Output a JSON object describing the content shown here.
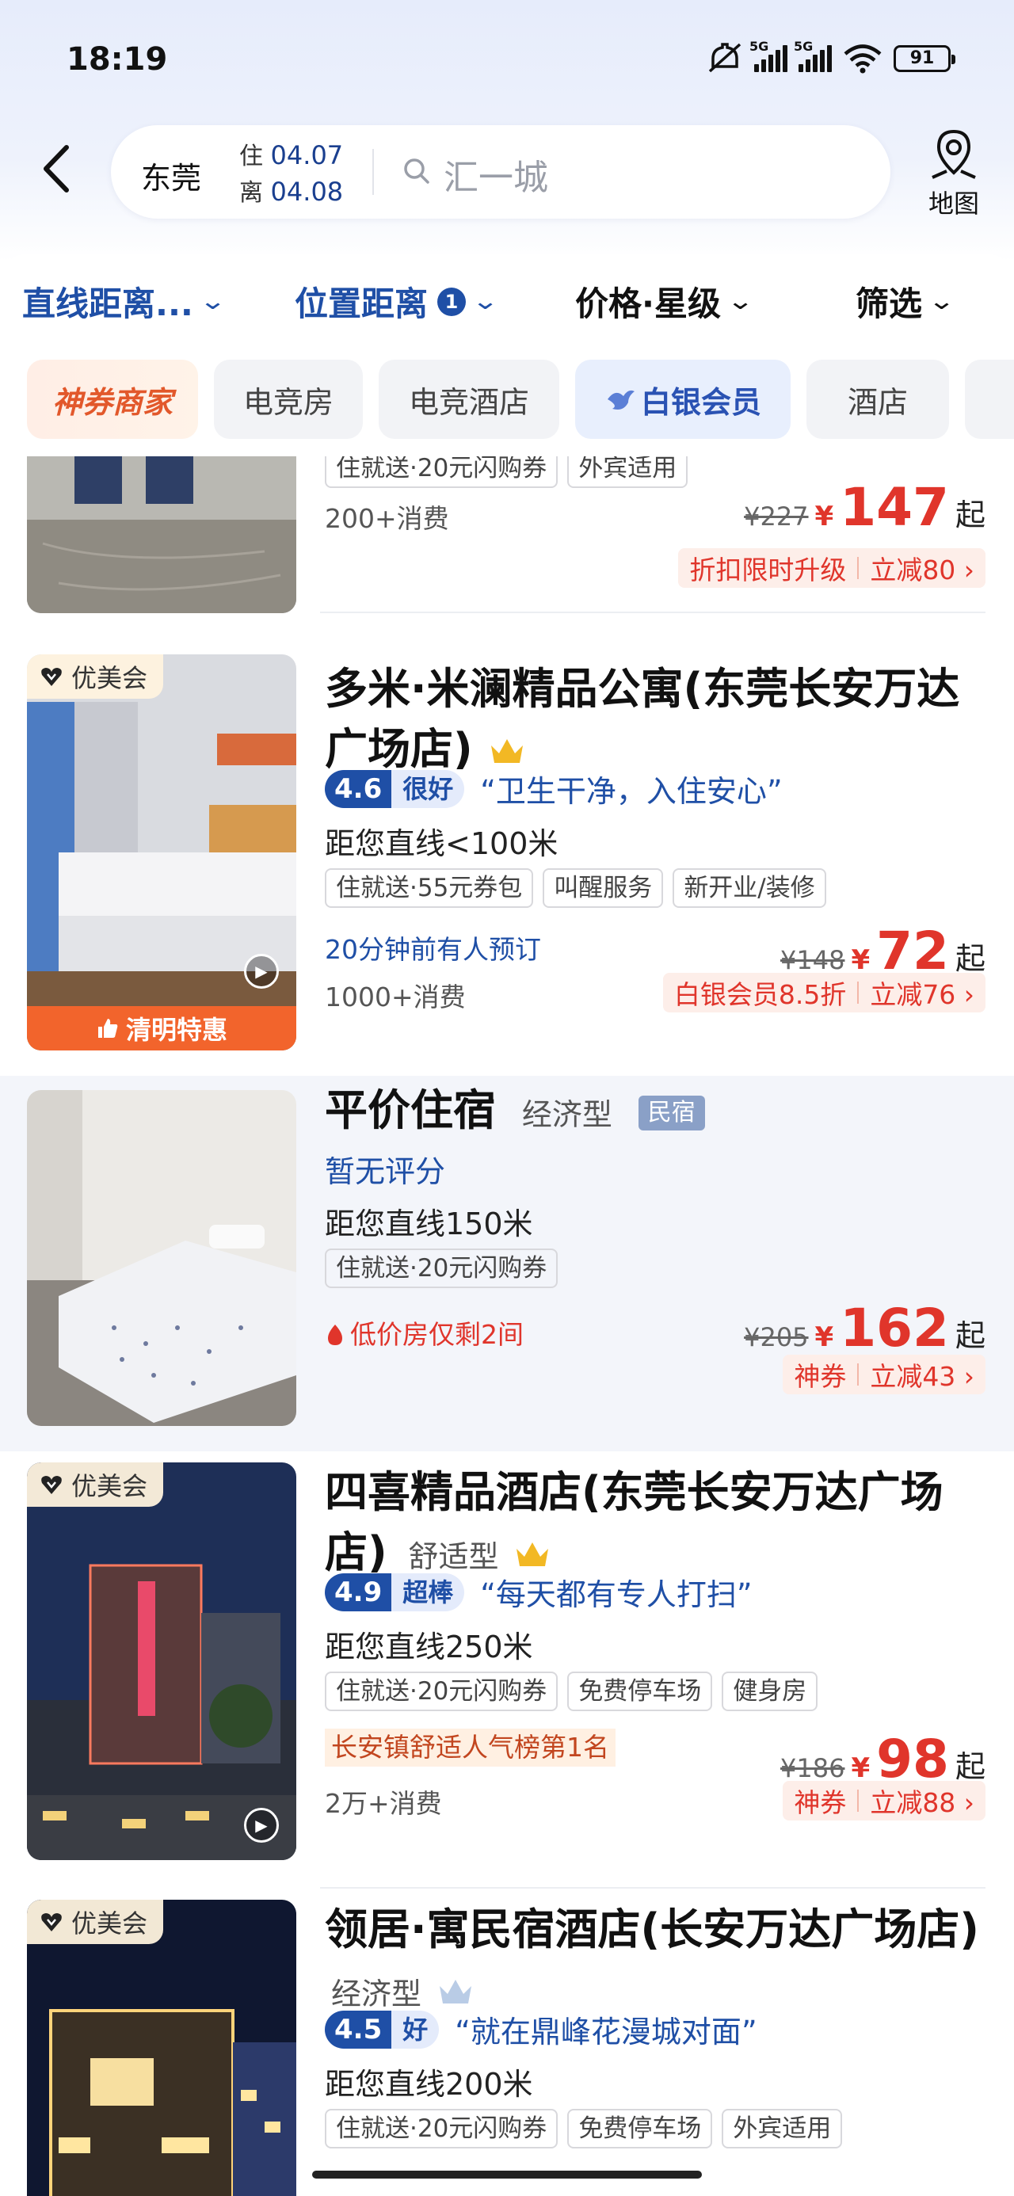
{
  "status_bar": {
    "time": "18:19",
    "battery": "91",
    "network_1": "5G",
    "network_2": "5G"
  },
  "search": {
    "city": "东莞",
    "checkin_label": "住",
    "checkin_date": "04.07",
    "checkout_label": "离",
    "checkout_date": "04.08",
    "query": "汇一城",
    "map_label": "地图"
  },
  "filters": [
    {
      "label": "直线距离..."
    },
    {
      "label": "位置距离",
      "count": "1"
    },
    {
      "label": "价格·星级"
    },
    {
      "label": "筛选"
    }
  ],
  "quick_tags": [
    "神券商家",
    "电竞房",
    "电竞酒店",
    "白银会员",
    "酒店"
  ],
  "hotels": [
    {
      "tags": [
        "住就送·20元闪购券",
        "外宾适用"
      ],
      "consume": "200+消费",
      "orig_price": "¥227",
      "currency": "¥",
      "price": "147",
      "suffix": "起",
      "discount_name": "折扣限时升级",
      "discount_amount": "立减80 ›"
    },
    {
      "badge": "优美会",
      "promo": "清明特惠",
      "name": "多米·米澜精品公寓(东莞长安万达广场店)",
      "score": "4.6",
      "score_word": "很好",
      "quote": "“卫生干净，入住安心”",
      "distance": "距您直线<100米",
      "tags": [
        "住就送·55元券包",
        "叫醒服务",
        "新开业/装修"
      ],
      "note": "20分钟前有人预订",
      "consume": "1000+消费",
      "orig_price": "¥148",
      "currency": "¥",
      "price": "72",
      "suffix": "起",
      "discount_name": "白银会员8.5折",
      "discount_amount": "立减76 ›"
    },
    {
      "name": "平价住宿",
      "type": "经济型",
      "label": "民宿",
      "no_score": "暂无评分",
      "distance": "距您直线150米",
      "tags": [
        "住就送·20元闪购券"
      ],
      "note": "低价房仅剩2间",
      "orig_price": "¥205",
      "currency": "¥",
      "price": "162",
      "suffix": "起",
      "discount_name": "神券",
      "discount_amount": "立减43 ›"
    },
    {
      "badge": "优美会",
      "name": "四喜精品酒店(东莞长安万达广场店)",
      "type": "舒适型",
      "score": "4.9",
      "score_word": "超棒",
      "quote": "“每天都有专人打扫”",
      "distance": "距您直线250米",
      "tags": [
        "住就送·20元闪购券",
        "免费停车场",
        "健身房"
      ],
      "note": "长安镇舒适人气榜第1名",
      "consume": "2万+消费",
      "orig_price": "¥186",
      "currency": "¥",
      "price": "98",
      "suffix": "起",
      "discount_name": "神券",
      "discount_amount": "立减88 ›"
    },
    {
      "badge": "优美会",
      "name": "领居·寓民宿酒店(长安万达广场店)",
      "type": "经济型",
      "score": "4.5",
      "score_word": "好",
      "quote": "“就在鼎峰花漫城对面”",
      "distance": "距您直线200米",
      "tags": [
        "住就送·20元闪购券",
        "免费停车场",
        "外宾适用"
      ]
    }
  ],
  "colors": {
    "accent_blue": "#1f4fa6",
    "price_red": "#e0352b",
    "promo_orange": "#f2642c"
  }
}
